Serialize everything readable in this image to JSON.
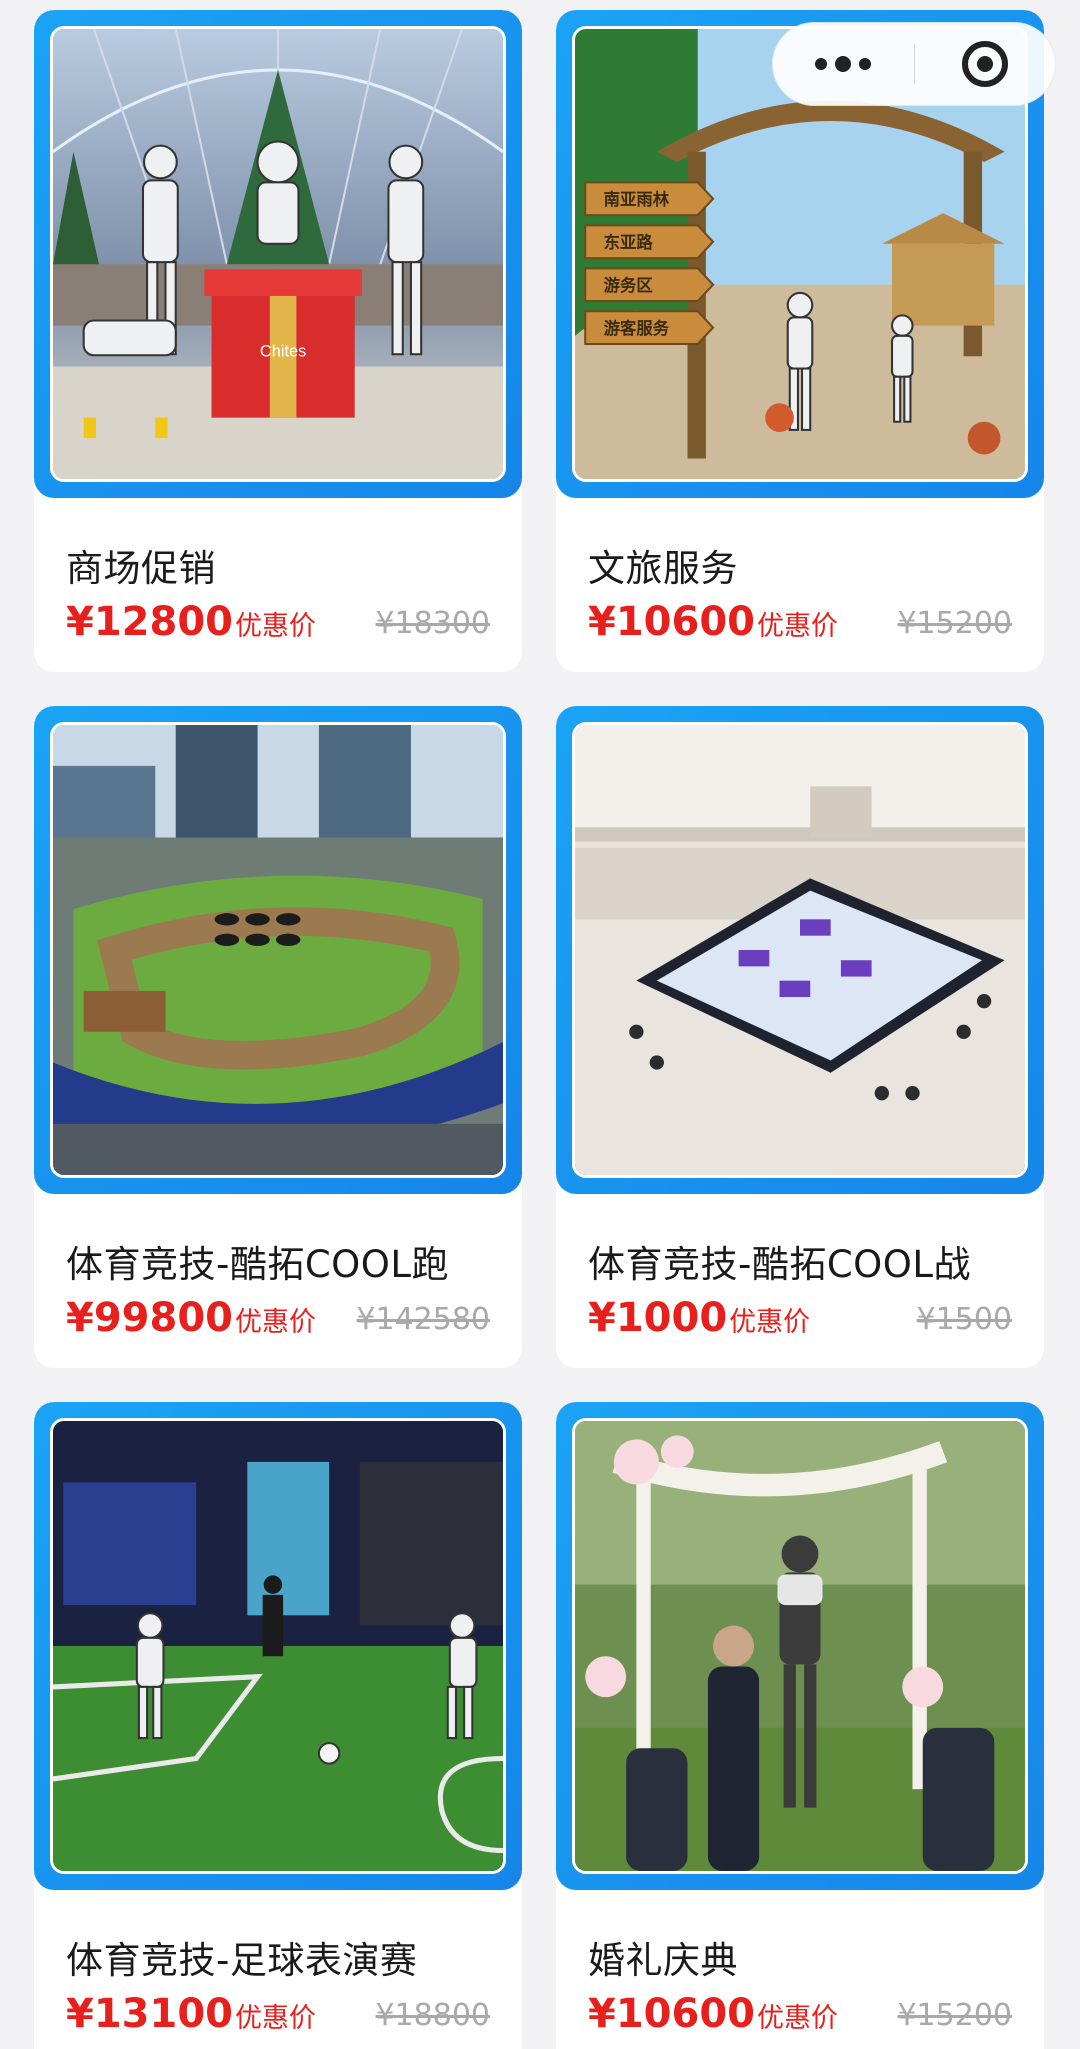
{
  "capsule": {
    "more_icon": "ellipsis-icon",
    "close_icon": "target-close-icon"
  },
  "products": [
    {
      "title": "商场促销",
      "price": "¥12800",
      "price_tag": "优惠价",
      "original_price": "¥18300",
      "image_label": "Chites"
    },
    {
      "title": "文旅服务",
      "price": "¥10600",
      "price_tag": "优惠价",
      "original_price": "¥15200",
      "signs": [
        "南亚雨林",
        "东亚路",
        "游务区",
        "游客服务"
      ]
    },
    {
      "title": "体育竞技-酷拓COOL跑",
      "price": "¥99800",
      "price_tag": "优惠价",
      "original_price": "¥142580"
    },
    {
      "title": "体育竞技-酷拓COOL战",
      "price": "¥1000",
      "price_tag": "优惠价",
      "original_price": "¥1500"
    },
    {
      "title": "体育竞技-足球表演赛",
      "price": "¥13100",
      "price_tag": "优惠价",
      "original_price": "¥18800"
    },
    {
      "title": "婚礼庆典",
      "price": "¥10600",
      "price_tag": "优惠价",
      "original_price": "¥15200"
    }
  ]
}
